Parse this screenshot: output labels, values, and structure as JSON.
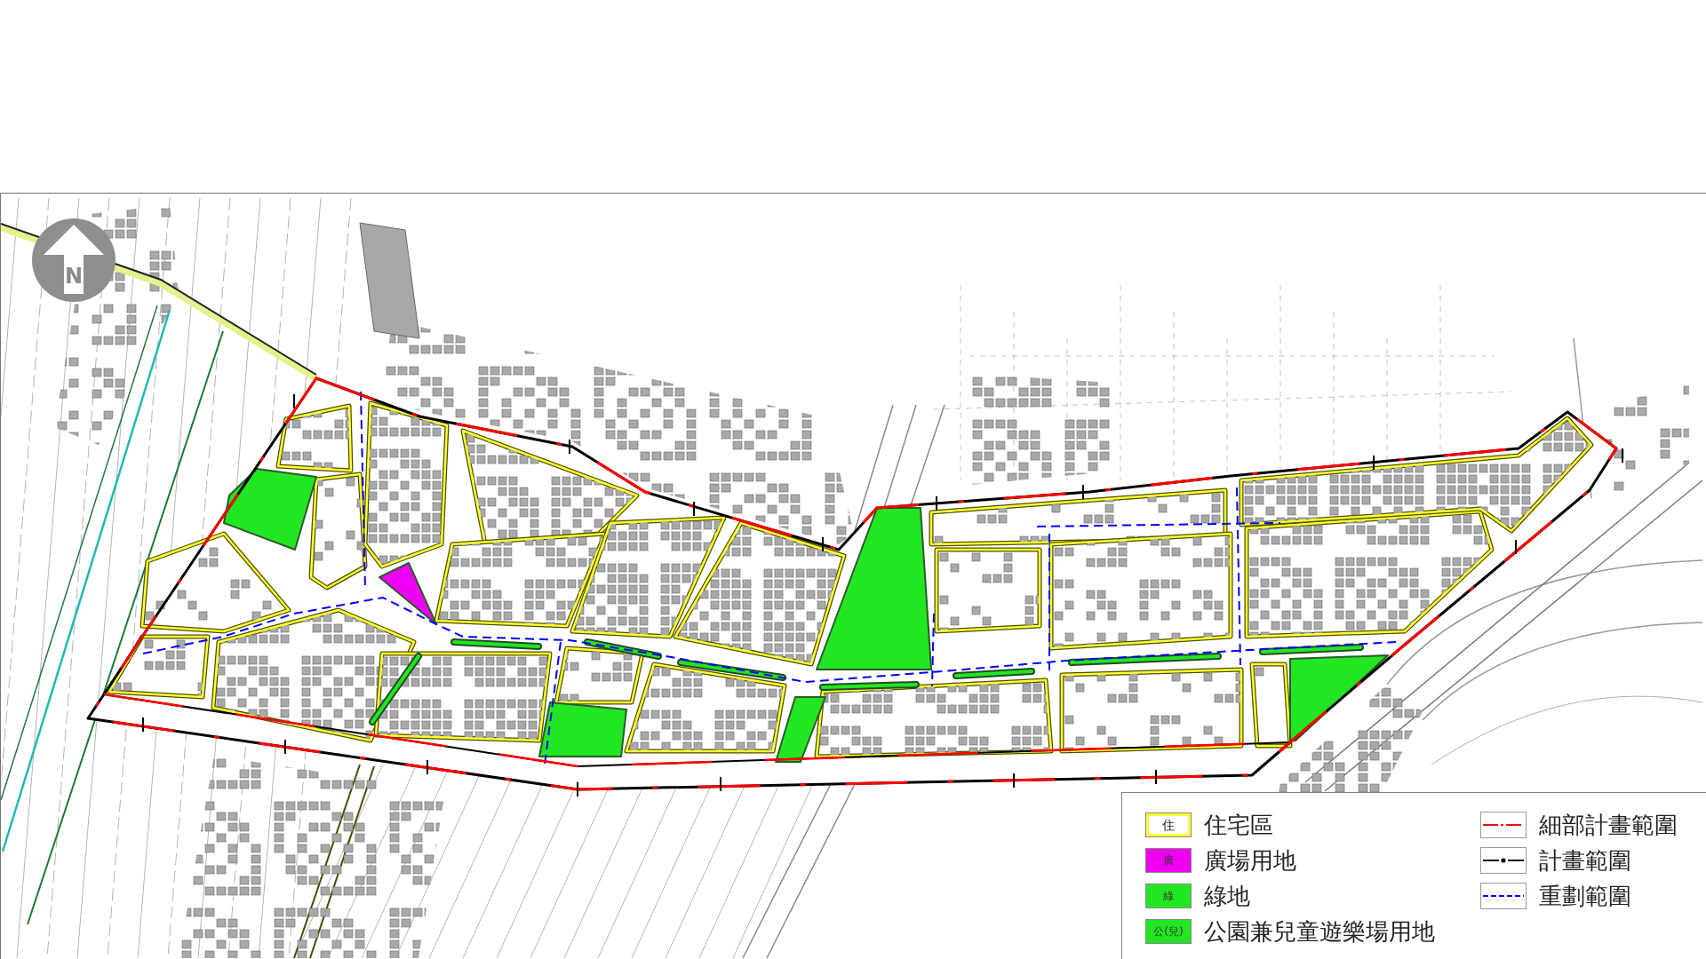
{
  "north_arrow": {
    "letter": "N"
  },
  "legend": {
    "zones": [
      {
        "kind": "outline",
        "symbol": "住",
        "label": "住宅區",
        "color": "#ffff33"
      },
      {
        "kind": "fill",
        "symbol": "廣",
        "label": "廣場用地",
        "color": "#f000f0"
      },
      {
        "kind": "fill",
        "symbol": "綠",
        "label": "綠地",
        "color": "#22e622"
      },
      {
        "kind": "fill",
        "symbol": "公(兒)",
        "label": "公園兼兒童遊樂場用地",
        "color": "#22e622"
      }
    ],
    "boundaries": [
      {
        "kind": "dash-dot",
        "label": "細部計畫範圍",
        "color": "#ff0000"
      },
      {
        "kind": "dot-line",
        "label": "計畫範圍",
        "color": "#000000"
      },
      {
        "kind": "dashed",
        "label": "重劃範圍",
        "color": "#0000ff"
      }
    ]
  }
}
